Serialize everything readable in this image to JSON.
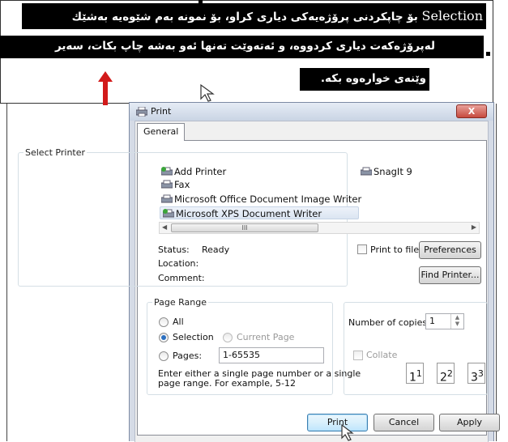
{
  "document": {
    "line1_word": "Selection",
    "line1": "بۆ چاپکردنی پرۆژەیەکی دیاری کراو، بۆ نمونە بەم شێوەیە بەشێك",
    "line2": "لەپرۆژەکەت دیاری کردووە، و ئەتەوێت تەنها ئەو بەشە چاپ بکات، سەیر",
    "line3": "وێنەی خوارەوە بکە."
  },
  "dialog": {
    "title": "Print",
    "close_label": "X",
    "tab_general": "General",
    "select_printer_legend": "Select Printer",
    "printers": [
      {
        "name": "Add Printer",
        "icon": "add-printer-icon"
      },
      {
        "name": "Fax",
        "icon": "printer-icon"
      },
      {
        "name": "Microsoft Office Document Image Writer",
        "icon": "printer-icon"
      },
      {
        "name": "Microsoft XPS Document Writer",
        "icon": "printer-icon",
        "selected": true
      },
      {
        "name": "SnagIt 9",
        "icon": "printer-icon"
      }
    ],
    "scroll_thumb": "III",
    "status_label": "Status:",
    "status_value": "Ready",
    "location_label": "Location:",
    "comment_label": "Comment:",
    "print_to_file": "Print to file",
    "preferences": "Preferences",
    "find_printer": "Find Printer...",
    "page_range_legend": "Page Range",
    "range_all": "All",
    "range_selection": "Selection",
    "range_current": "Current Page",
    "range_pages": "Pages:",
    "pages_value": "1-65535",
    "range_hint_1": "Enter either a single page number or a single",
    "range_hint_2": "page range.  For example, 5-12",
    "copies_label": "Number of copies:",
    "copies_value": "1",
    "collate": "Collate",
    "collate_pages": [
      "1",
      "1",
      "2",
      "2",
      "3",
      "3"
    ],
    "btn_print": "Print",
    "btn_cancel": "Cancel",
    "btn_apply": "Apply"
  },
  "colors": {
    "selection_bg": "#000000",
    "annotation_arrow": "#d21a1a",
    "close_button": "#c64a3e"
  }
}
